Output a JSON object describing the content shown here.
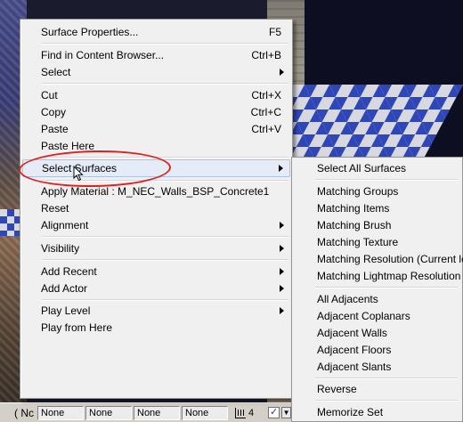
{
  "statusbar": {
    "prefix": "( Nc",
    "fields": [
      "None",
      "None",
      "None",
      "None"
    ],
    "grid_value": "4",
    "check_mark": "✓",
    "dropdown_glyph": "▼"
  },
  "context_menu": {
    "items": [
      {
        "label": "Surface Properties...",
        "shortcut": "F5"
      },
      {
        "label": "Find in Content Browser...",
        "shortcut": "Ctrl+B"
      },
      {
        "label": "Select",
        "submenu": true
      },
      {
        "label": "Cut",
        "shortcut": "Ctrl+X"
      },
      {
        "label": "Copy",
        "shortcut": "Ctrl+C"
      },
      {
        "label": "Paste",
        "shortcut": "Ctrl+V"
      },
      {
        "label": "Paste Here"
      },
      {
        "label": "Select Surfaces",
        "submenu": true,
        "highlighted": true
      },
      {
        "label": "Apply Material : M_NEC_Walls_BSP_Concrete1"
      },
      {
        "label": "Reset"
      },
      {
        "label": "Alignment",
        "submenu": true
      },
      {
        "label": "Visibility",
        "submenu": true
      },
      {
        "label": "Add Recent",
        "submenu": true
      },
      {
        "label": "Add Actor",
        "submenu": true
      },
      {
        "label": "Play Level",
        "submenu": true
      },
      {
        "label": "Play from Here"
      }
    ]
  },
  "submenu": {
    "items": [
      "Select All Surfaces",
      "Matching Groups",
      "Matching Items",
      "Matching Brush",
      "Matching Texture",
      "Matching Resolution (Current level)",
      "Matching Lightmap Resolution",
      "All Adjacents",
      "Adjacent Coplanars",
      "Adjacent Walls",
      "Adjacent Floors",
      "Adjacent Slants",
      "Reverse",
      "Memorize Set"
    ]
  },
  "colors": {
    "menu_bg": "#f0f0f0",
    "highlight_bg": "#e5ecf7",
    "highlight_border": "#a8c3e8",
    "annotation": "#e02020",
    "floor_blue": "#2f46b8"
  }
}
